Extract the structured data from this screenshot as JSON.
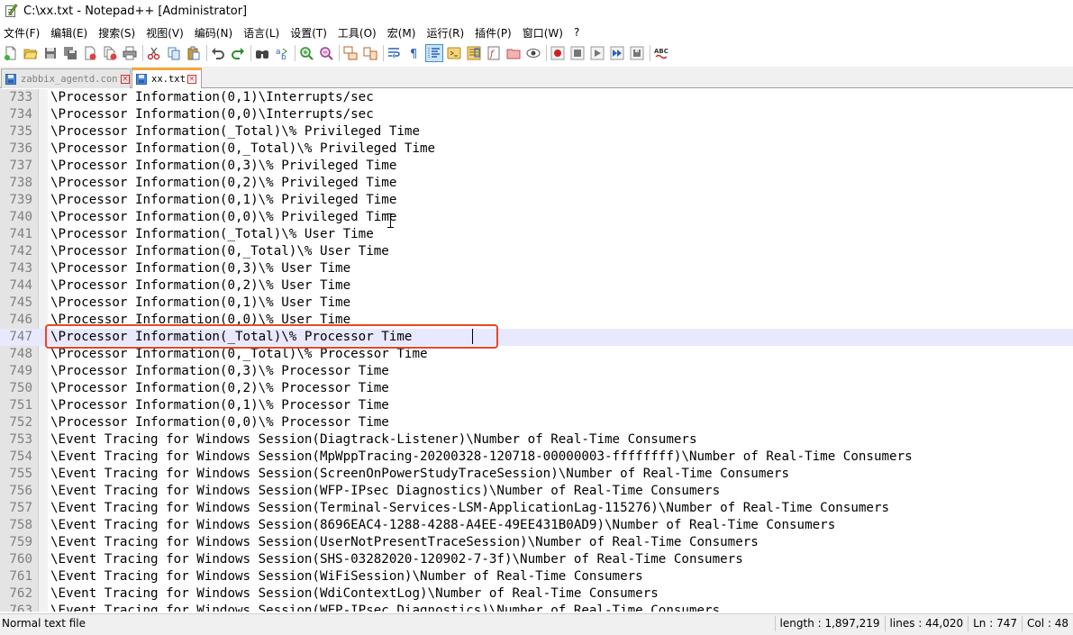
{
  "window": {
    "title": "C:\\xx.txt - Notepad++ [Administrator]"
  },
  "menu": [
    "文件(F)",
    "编辑(E)",
    "搜索(S)",
    "视图(V)",
    "编码(N)",
    "语言(L)",
    "设置(T)",
    "工具(O)",
    "宏(M)",
    "运行(R)",
    "插件(P)",
    "窗口(W)",
    "?"
  ],
  "toolbar_icons": [
    "new-file-icon",
    "open-file-icon",
    "save-icon",
    "save-all-icon",
    "close-icon",
    "close-all-icon",
    "print-icon",
    "cut-icon",
    "copy-icon",
    "paste-icon",
    "undo-icon",
    "redo-icon",
    "find-icon",
    "replace-icon",
    "zoom-in-icon",
    "zoom-out-icon",
    "sync-vertical-icon",
    "sync-horizontal-icon",
    "word-wrap-icon",
    "show-all-characters-icon",
    "indent-guide-icon",
    "language-icon",
    "document-map-icon",
    "function-list-icon",
    "folder-as-workspace-icon",
    "monitoring-icon",
    "record-macro-icon",
    "stop-macro-icon",
    "playback-macro-icon",
    "run-macro-multiple-icon",
    "save-macro-icon",
    "spell-check-icon"
  ],
  "tabs": [
    {
      "label": "zabbix_agentd.conf",
      "active": false
    },
    {
      "label": "xx.txt",
      "active": true
    }
  ],
  "editor": {
    "current_line": 747,
    "lines": [
      {
        "n": "733",
        "t": "\\Processor Information(0,1)\\Interrupts/sec"
      },
      {
        "n": "734",
        "t": "\\Processor Information(0,0)\\Interrupts/sec"
      },
      {
        "n": "735",
        "t": "\\Processor Information(_Total)\\% Privileged Time"
      },
      {
        "n": "736",
        "t": "\\Processor Information(0,_Total)\\% Privileged Time"
      },
      {
        "n": "737",
        "t": "\\Processor Information(0,3)\\% Privileged Time"
      },
      {
        "n": "738",
        "t": "\\Processor Information(0,2)\\% Privileged Time"
      },
      {
        "n": "739",
        "t": "\\Processor Information(0,1)\\% Privileged Time"
      },
      {
        "n": "740",
        "t": "\\Processor Information(0,0)\\% Privileged Time"
      },
      {
        "n": "741",
        "t": "\\Processor Information(_Total)\\% User Time"
      },
      {
        "n": "742",
        "t": "\\Processor Information(0,_Total)\\% User Time"
      },
      {
        "n": "743",
        "t": "\\Processor Information(0,3)\\% User Time"
      },
      {
        "n": "744",
        "t": "\\Processor Information(0,2)\\% User Time"
      },
      {
        "n": "745",
        "t": "\\Processor Information(0,1)\\% User Time"
      },
      {
        "n": "746",
        "t": "\\Processor Information(0,0)\\% User Time"
      },
      {
        "n": "747",
        "t": "\\Processor Information(_Total)\\% Processor Time"
      },
      {
        "n": "748",
        "t": "\\Processor Information(0,_Total)\\% Processor Time"
      },
      {
        "n": "749",
        "t": "\\Processor Information(0,3)\\% Processor Time"
      },
      {
        "n": "750",
        "t": "\\Processor Information(0,2)\\% Processor Time"
      },
      {
        "n": "751",
        "t": "\\Processor Information(0,1)\\% Processor Time"
      },
      {
        "n": "752",
        "t": "\\Processor Information(0,0)\\% Processor Time"
      },
      {
        "n": "753",
        "t": "\\Event Tracing for Windows Session(Diagtrack-Listener)\\Number of Real-Time Consumers"
      },
      {
        "n": "754",
        "t": "\\Event Tracing for Windows Session(MpWppTracing-20200328-120718-00000003-ffffffff)\\Number of Real-Time Consumers"
      },
      {
        "n": "755",
        "t": "\\Event Tracing for Windows Session(ScreenOnPowerStudyTraceSession)\\Number of Real-Time Consumers"
      },
      {
        "n": "756",
        "t": "\\Event Tracing for Windows Session(WFP-IPsec Diagnostics)\\Number of Real-Time Consumers"
      },
      {
        "n": "757",
        "t": "\\Event Tracing for Windows Session(Terminal-Services-LSM-ApplicationLag-115276)\\Number of Real-Time Consumers"
      },
      {
        "n": "758",
        "t": "\\Event Tracing for Windows Session(8696EAC4-1288-4288-A4EE-49EE431B0AD9)\\Number of Real-Time Consumers"
      },
      {
        "n": "759",
        "t": "\\Event Tracing for Windows Session(UserNotPresentTraceSession)\\Number of Real-Time Consumers"
      },
      {
        "n": "760",
        "t": "\\Event Tracing for Windows Session(SHS-03282020-120902-7-3f)\\Number of Real-Time Consumers"
      },
      {
        "n": "761",
        "t": "\\Event Tracing for Windows Session(WiFiSession)\\Number of Real-Time Consumers"
      },
      {
        "n": "762",
        "t": "\\Event Tracing for Windows Session(WdiContextLog)\\Number of Real-Time Consumers"
      },
      {
        "n": "763",
        "t": "\\Event Tracing for Windows Session(WFP-IPsec Diagnostics)\\Number of Real-Time Consumers"
      }
    ]
  },
  "status": {
    "type": "Normal text file",
    "length": "length : 1,897,219",
    "lines": "lines : 44,020",
    "ln": "Ln : 747",
    "col": "Col : 48"
  },
  "colors": {
    "highlight_box": "#e8472b",
    "current_line": "#e8e8ff",
    "active_tab_accent": "#f7a63c"
  }
}
